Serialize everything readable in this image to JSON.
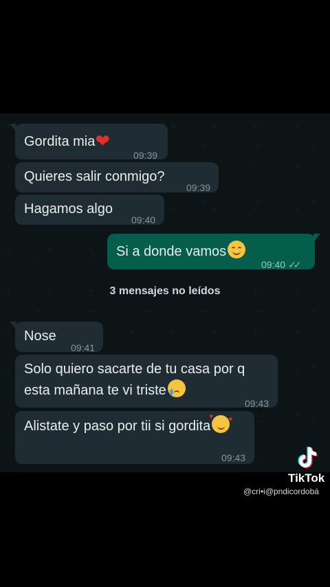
{
  "messages": [
    {
      "id": "m1",
      "dir": "in",
      "text": "Gordita mia",
      "emoji": "heart",
      "time": "09:39"
    },
    {
      "id": "m2",
      "dir": "in",
      "text": "Quieres salir conmigo?",
      "time": "09:39"
    },
    {
      "id": "m3",
      "dir": "in",
      "text": "Hagamos algo",
      "time": "09:40"
    },
    {
      "id": "m4",
      "dir": "out",
      "text": "Si a donde vamos",
      "emoji": "smile",
      "time": "09:40",
      "status": "read"
    },
    {
      "id": "m5",
      "dir": "in",
      "text": "Nose",
      "time": "09:41"
    },
    {
      "id": "m6",
      "dir": "in",
      "line1": "Solo quiero sacarte de tu casa por q",
      "line2": "esta mañana te vi triste",
      "emoji": "cry",
      "time": "09:43"
    },
    {
      "id": "m7",
      "dir": "in",
      "text": "Alistate y paso por tii si gordita",
      "emoji": "love",
      "time": "09:43"
    }
  ],
  "unread_label": "3 mensajes no leídos",
  "watermark": {
    "brand": "TikTok",
    "handle": "@cri•i@pndicordobá"
  },
  "colors": {
    "incoming": "#1f2c33",
    "outgoing": "#055e4c",
    "background": "#0c1416"
  }
}
